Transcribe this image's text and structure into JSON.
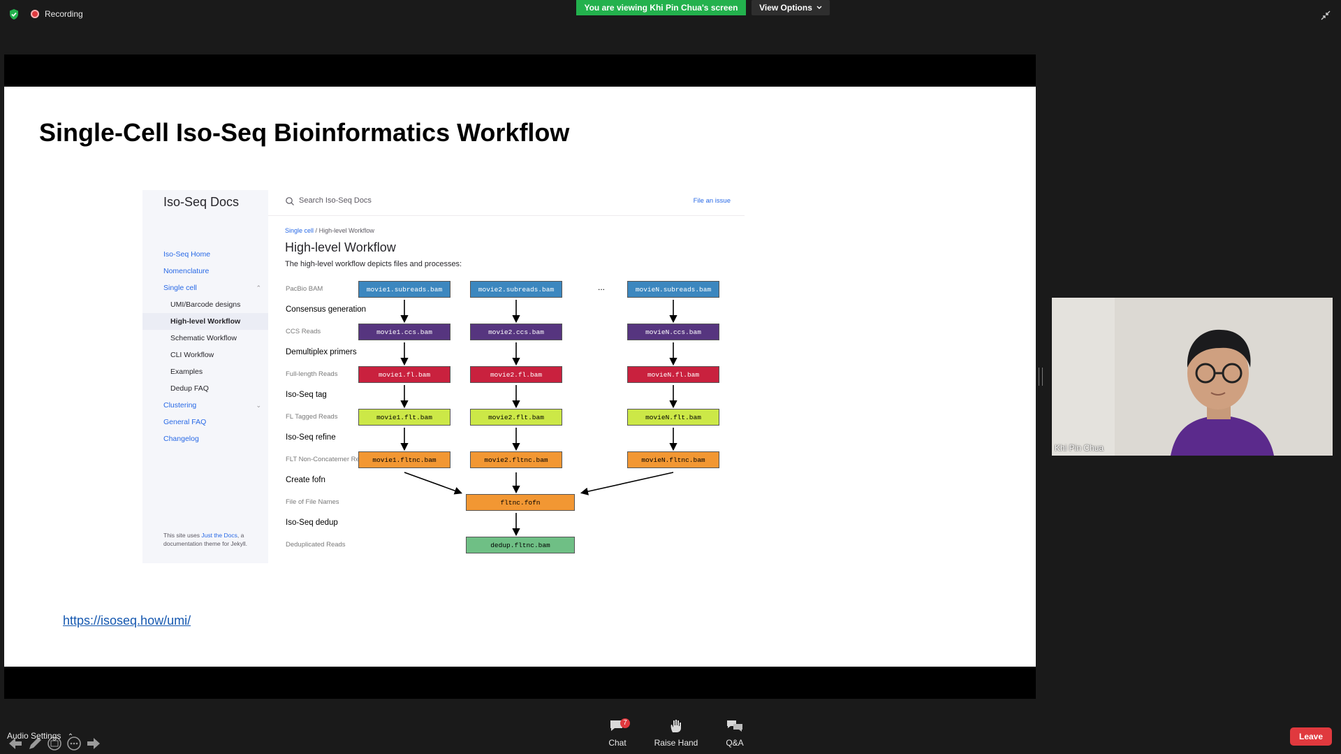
{
  "meeting": {
    "recording_label": "Recording",
    "viewing_banner": "You are viewing Khi Pin Chua's screen",
    "view_options_label": "View Options",
    "audio_settings_label": "Audio Settings",
    "leave_label": "Leave",
    "participant_name": "Khi Pin Chua",
    "toolbar": [
      {
        "label": "Chat",
        "badge": "7",
        "icon": "chat-icon"
      },
      {
        "label": "Raise Hand",
        "icon": "hand-icon"
      },
      {
        "label": "Q&A",
        "icon": "qa-icon"
      }
    ]
  },
  "slide": {
    "title": "Single-Cell Iso-Seq Bioinformatics Workflow",
    "url": "https://isoseq.how/umi/"
  },
  "docs": {
    "logo": "Iso-Seq Docs",
    "search_placeholder": "Search Iso-Seq Docs",
    "file_issue": "File an issue",
    "nav": [
      {
        "label": "Iso-Seq Home"
      },
      {
        "label": "Nomenclature"
      },
      {
        "label": "Single cell"
      },
      {
        "label": "UMI/Barcode designs"
      },
      {
        "label": "High-level Workflow"
      },
      {
        "label": "Schematic Workflow"
      },
      {
        "label": "CLI Workflow"
      },
      {
        "label": "Examples"
      },
      {
        "label": "Dedup FAQ"
      },
      {
        "label": "Clustering"
      },
      {
        "label": "General FAQ"
      },
      {
        "label": "Changelog"
      }
    ],
    "footer_pre": "This site uses",
    "footer_link": "Just the Docs",
    "footer_post": ", a documentation theme for Jekyll.",
    "breadcrumb_parent": "Single cell",
    "breadcrumb_sep": "/",
    "breadcrumb_current": "High-level Workflow",
    "heading": "High-level Workflow",
    "intro": "The high-level workflow depicts files and processes:",
    "ellipsis": "...",
    "steps": [
      "Consensus generation",
      "Demultiplex primers",
      "Iso-Seq tag",
      "Iso-Seq refine",
      "Create fofn",
      "Iso-Seq dedup"
    ],
    "data_types": [
      "PacBio BAM",
      "CCS Reads",
      "Full-length Reads",
      "FL Tagged Reads",
      "FLT Non-Concatemer Reads",
      "File of File Names",
      "Deduplicated Reads"
    ],
    "files": {
      "col1": [
        "movie1.subreads.bam",
        "movie1.ccs.bam",
        "movie1.fl.bam",
        "movie1.flt.bam",
        "movie1.fltnc.bam"
      ],
      "col2": [
        "movie2.subreads.bam",
        "movie2.ccs.bam",
        "movie2.fl.bam",
        "movie2.flt.bam",
        "movie2.fltnc.bam"
      ],
      "colN": [
        "movieN.subreads.bam",
        "movieN.ccs.bam",
        "movieN.fl.bam",
        "movieN.flt.bam",
        "movieN.fltnc.bam"
      ],
      "fofn": "fltnc.fofn",
      "dedup": "dedup.fltnc.bam"
    },
    "row_colors": [
      "#3c87bf",
      "#56357f",
      "#c9213e",
      "#cce847",
      "#f29733"
    ],
    "fofn_color": "#f29733",
    "dedup_color": "#6fbf85"
  }
}
